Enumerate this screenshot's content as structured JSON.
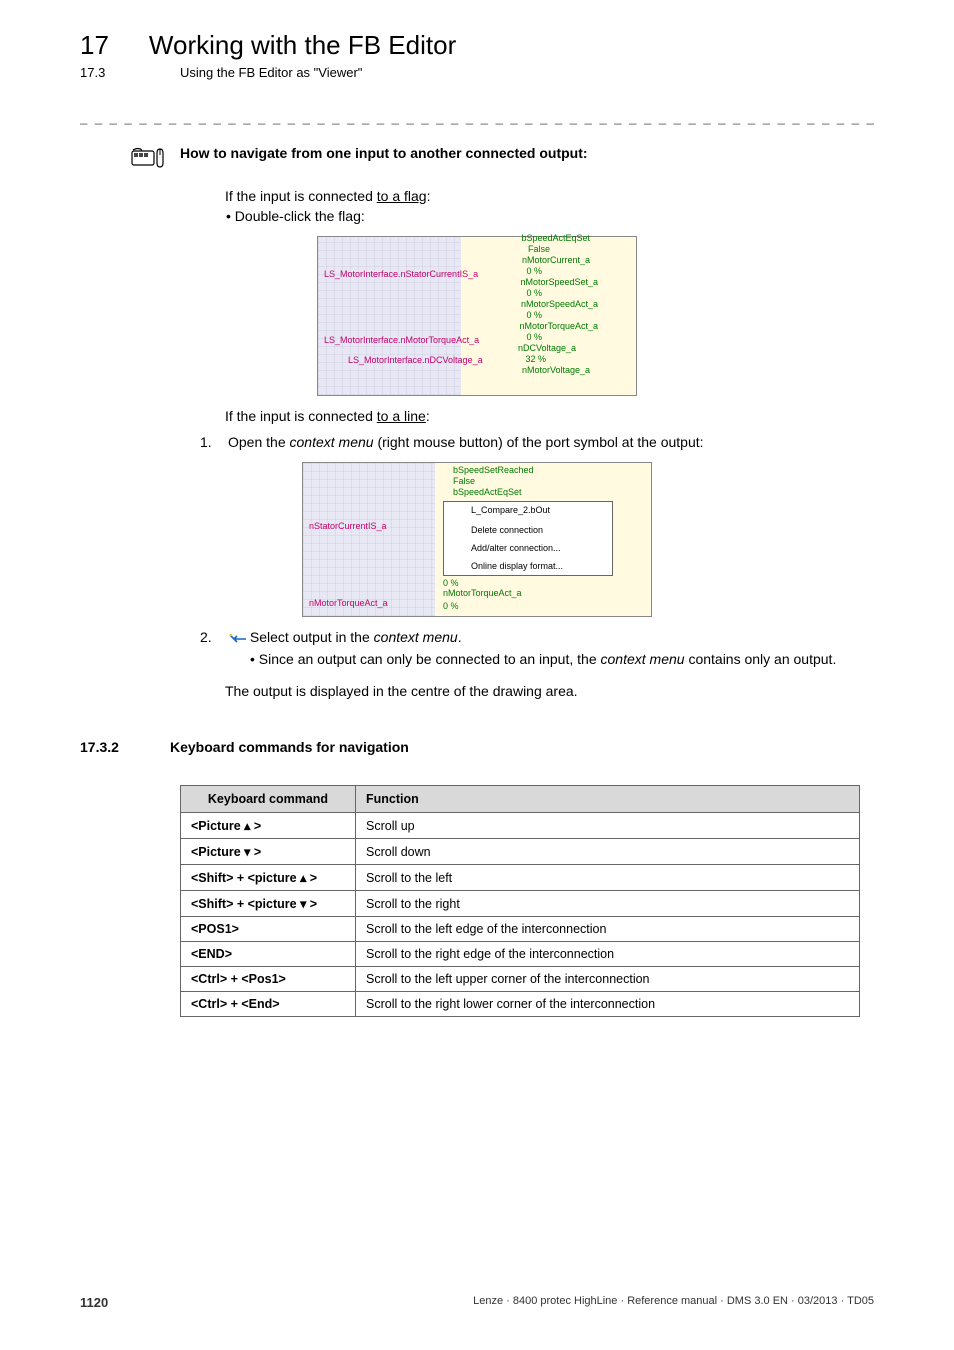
{
  "header": {
    "chapter_num": "17",
    "chapter_title": "Working with the FB Editor",
    "sub_num": "17.3",
    "sub_title": "Using the FB Editor as \"Viewer\""
  },
  "howto": {
    "title": "How to navigate from one input to another connected output:",
    "flag_intro_a": "If the input is connected ",
    "flag_intro_b": "to a flag",
    "flag_intro_c": ":",
    "flag_bullet": "Double-click the flag:",
    "line_intro_a": "If the input is connected ",
    "line_intro_b": "to a line",
    "line_intro_c": ":",
    "step1_num": "1.",
    "step1_a": "Open the ",
    "step1_b": "context menu",
    "step1_c": " (right mouse button) of the port symbol at the output:",
    "step2_num": "2.",
    "step2_a": "Select  output in the ",
    "step2_b": "context menu",
    "step2_c": ".",
    "step2_sub_a": "Since an output can only be connected to an input, the ",
    "step2_sub_b": "context menu",
    "step2_sub_c": " contains only an output.",
    "result": "The output is displayed in the centre of the drawing area."
  },
  "img1_labels": {
    "l1": "LS_MotorInterface.nStatorCurrentIS_a",
    "l2": "LS_MotorInterface.nMotorTorqueAct_a",
    "l3": "LS_MotorInterface.nDCVoltage_a",
    "r0": "bSpeedActEqSet",
    "r0b": "False",
    "r1": "nMotorCurrent_a",
    "r1b": "0 %",
    "r2": "nMotorSpeedSet_a",
    "r2b": "0 %",
    "r3": "nMotorSpeedAct_a",
    "r3b": "0 %",
    "r4": "nMotorTorqueAct_a",
    "r4b": "0 %",
    "r5": "nDCVoltage_a",
    "r5b": "32 %",
    "r6": "nMotorVoltage_a"
  },
  "img2_labels": {
    "t1": "bSpeedSetReached",
    "t1b": "False",
    "t2": "bSpeedActEqSet",
    "m1": "L_Compare_2.bOut",
    "m2": "Delete connection",
    "m3": "Add/alter connection...",
    "m4": "Online display format...",
    "l1": "nStatorCurrentIS_a",
    "b1": "nMotorTorqueAct_a",
    "b1v": "0 %",
    "b2": "nMotorTorqueAct_a",
    "b2v": "0 %"
  },
  "section": {
    "num": "17.3.2",
    "title": "Keyboard commands for navigation"
  },
  "table": {
    "headers": {
      "cmd": "Keyboard command",
      "fn": "Function"
    },
    "rows": [
      {
        "cmd": "<Picture ▴ >",
        "fn": "Scroll up"
      },
      {
        "cmd": "<Picture ▾ >",
        "fn": "Scroll down"
      },
      {
        "cmd": "<Shift> + <picture ▴ >",
        "fn": "Scroll to the left"
      },
      {
        "cmd": "<Shift> + <picture ▾ >",
        "fn": "Scroll to the right"
      },
      {
        "cmd": "<POS1>",
        "fn": "Scroll to the left edge of the interconnection"
      },
      {
        "cmd": "<END>",
        "fn": "Scroll to the right edge of the interconnection"
      },
      {
        "cmd": "<Ctrl> + <Pos1>",
        "fn": "Scroll to the left upper corner of the interconnection"
      },
      {
        "cmd": "<Ctrl> + <End>",
        "fn": "Scroll to the right lower corner of the interconnection"
      }
    ]
  },
  "footer": {
    "page": "1120",
    "right": "Lenze · 8400 protec HighLine · Reference manual · DMS 3.0 EN · 03/2013 · TD05"
  },
  "dashes": "_ _ _ _ _ _ _ _ _ _ _ _ _ _ _ _ _ _ _ _ _ _ _ _ _ _ _ _ _ _ _ _ _ _ _ _ _ _ _ _ _ _ _ _ _ _ _ _ _ _ _ _ _ _ _ _ _ _ _ _ _ _ _ _"
}
